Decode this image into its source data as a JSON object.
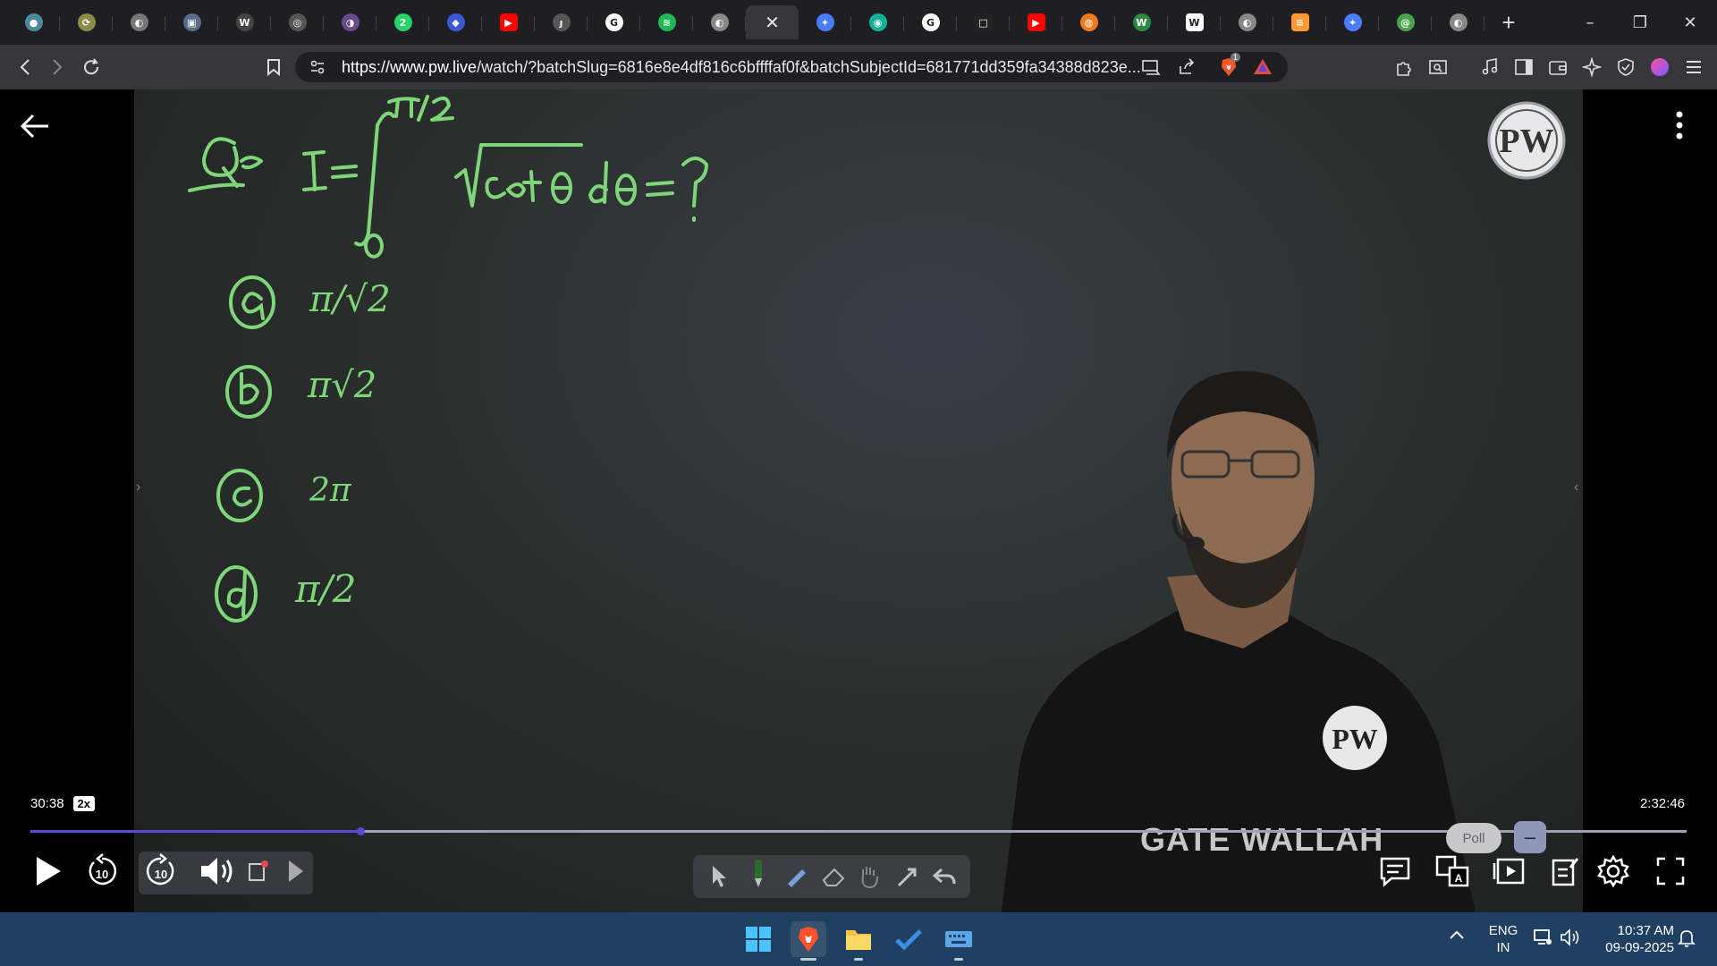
{
  "browser": {
    "tabs": [
      {
        "icon": "ai-chat-icon",
        "glyph": "●",
        "color": "#4b8a9c"
      },
      {
        "icon": "ai-coin-icon",
        "glyph": "⟳",
        "color": "#8b8b4a"
      },
      {
        "icon": "generic-globe-icon",
        "glyph": "◐",
        "color": "#777"
      },
      {
        "icon": "app-icon",
        "glyph": "▣",
        "color": "#5a6b8c"
      },
      {
        "icon": "w3schools-icon",
        "glyph": "W",
        "color": "#444"
      },
      {
        "icon": "extension-icon",
        "glyph": "◎",
        "color": "#555"
      },
      {
        "icon": "purple-app-icon",
        "glyph": "◑",
        "color": "#6a4a8a"
      },
      {
        "icon": "whatsapp-icon",
        "glyph": "2",
        "color": "#25d366"
      },
      {
        "icon": "bookmark-tab-icon",
        "glyph": "◆",
        "color": "#3a59d9"
      },
      {
        "icon": "youtube-icon",
        "glyph": "▶",
        "color": "#ff0000"
      },
      {
        "icon": "pw-dark-icon",
        "glyph": "ȷ",
        "color": "#555"
      },
      {
        "icon": "google-icon",
        "glyph": "G",
        "color": "#ffffff"
      },
      {
        "icon": "spotify-icon",
        "glyph": "≋",
        "color": "#1db954"
      },
      {
        "icon": "globe-icon",
        "glyph": "◐",
        "color": "#888"
      },
      {
        "icon": "close-tab-icon",
        "glyph": "✕",
        "color": "#36363c"
      },
      {
        "icon": "gemini-icon",
        "glyph": "✦",
        "color": "#4a7cff"
      },
      {
        "icon": "copilot-icon",
        "glyph": "◉",
        "color": "#10b39a"
      },
      {
        "icon": "google-icon",
        "glyph": "G",
        "color": "#ffffff"
      },
      {
        "icon": "window-icon",
        "glyph": "□",
        "color": "#222"
      },
      {
        "icon": "youtube-icon",
        "glyph": "▶",
        "color": "#ff0000"
      },
      {
        "icon": "orange-globe-icon",
        "glyph": "◍",
        "color": "#f47a20"
      },
      {
        "icon": "wallah-icon",
        "glyph": "W",
        "color": "#2b8a3e"
      },
      {
        "icon": "wikipedia-icon",
        "glyph": "W",
        "color": "#ffffff"
      },
      {
        "icon": "globe-icon",
        "glyph": "◐",
        "color": "#888"
      },
      {
        "icon": "india-flag-icon",
        "glyph": "≡",
        "color": "#ff9933"
      },
      {
        "icon": "gemini-icon",
        "glyph": "✦",
        "color": "#4a7cff"
      },
      {
        "icon": "green-app-icon",
        "glyph": "@",
        "color": "#4aa34a"
      },
      {
        "icon": "globe-icon",
        "glyph": "◐",
        "color": "#888"
      }
    ],
    "new_tab_label": "+",
    "window_controls": {
      "minimize": "–",
      "restore": "❐",
      "close": "✕"
    },
    "url_host": "https://www.pw.live",
    "url_path": "/watch/?batchSlug=6816e8e4df816c6bffffaf0f&batchSubjectId=681771dd359fa34388d823e...",
    "brave_shield_count": "1"
  },
  "player": {
    "current_time": "30:38",
    "speed": "2x",
    "total_time": "2:32:46",
    "progress_fraction": 0.199,
    "rewind_label": "10",
    "forward_label": "10",
    "poll_label": "Poll",
    "minimize_label": "–",
    "channel_watermark": "GATE WALLAH",
    "logo_text": "PW",
    "board": {
      "question_prefix": "Q.",
      "equation": "I = ∫₀^{π/2} √(cot θ) dθ = ?",
      "options": [
        {
          "label": "a",
          "value": "π/√2"
        },
        {
          "label": "b",
          "value": "π√2"
        },
        {
          "label": "c",
          "value": "2π"
        },
        {
          "label": "d",
          "value": "π/2"
        }
      ],
      "ink_color": "#7fd67a"
    }
  },
  "taskbar": {
    "language": "ENG",
    "region": "IN",
    "time": "10:37 AM",
    "date": "09-09-2025"
  }
}
